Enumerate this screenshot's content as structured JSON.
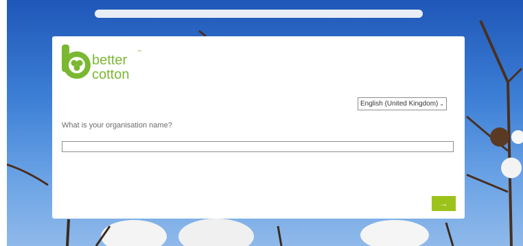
{
  "brand": {
    "logo_line1": "better",
    "logo_line2": "cotton",
    "logo_tm": "™",
    "green": "#7bb832"
  },
  "language_select": {
    "value": "English (United Kingdom)",
    "icon": "chevron-down-icon"
  },
  "form": {
    "question": "What is your organisation name?",
    "org_name_value": ""
  },
  "next_button": {
    "label": "→",
    "color": "#9bc31c"
  }
}
